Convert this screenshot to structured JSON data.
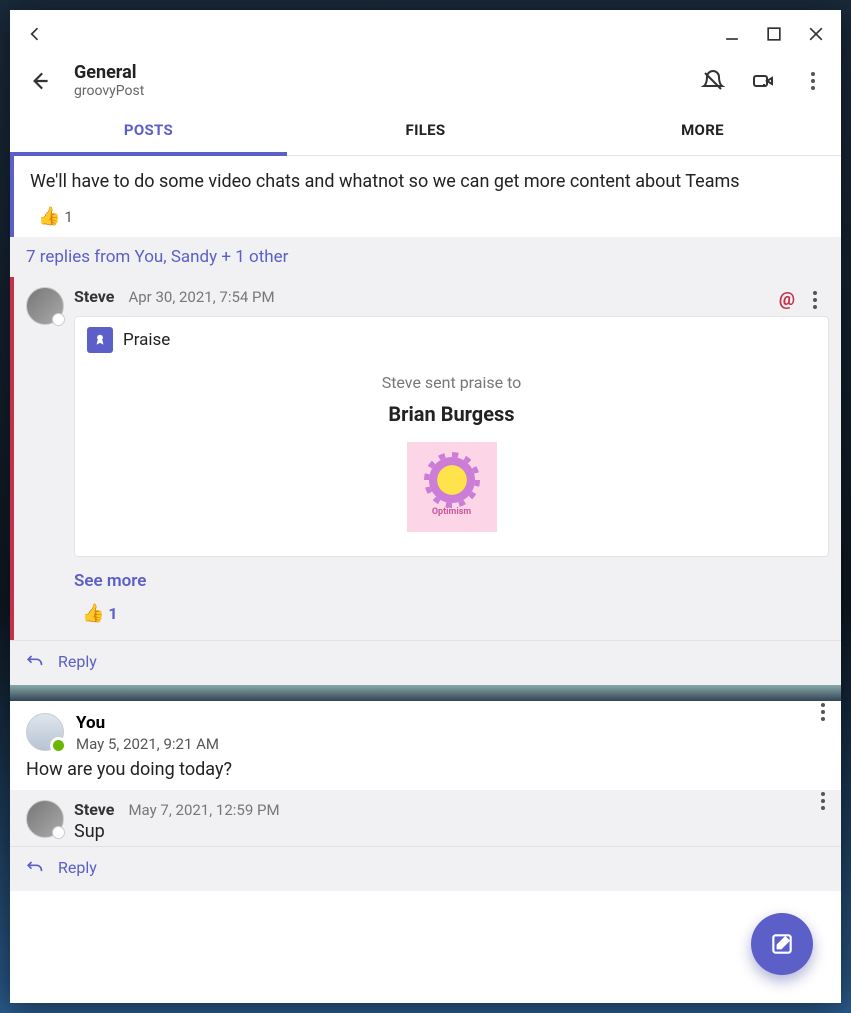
{
  "header": {
    "title": "General",
    "subtitle": "groovyPost"
  },
  "tabs": [
    {
      "label": "POSTS",
      "active": true
    },
    {
      "label": "FILES",
      "active": false
    },
    {
      "label": "MORE",
      "active": false
    }
  ],
  "root_post": {
    "text": "We'll have to do some video chats and whatnot so we can get more content about Teams",
    "reaction_count": "1",
    "replies_summary": "7 replies from You, Sandy + 1 other"
  },
  "praise_reply": {
    "author": "Steve",
    "timestamp": "Apr 30, 2021, 7:54 PM",
    "card_title": "Praise",
    "subtext": "Steve sent praise to",
    "target_name": "Brian Burgess",
    "stamp_label": "Optimism",
    "see_more": "See more",
    "reaction_count": "1"
  },
  "reply_label": "Reply",
  "you_post": {
    "author": "You",
    "timestamp": "May 5, 2021, 9:21 AM",
    "text": "How are you doing today?"
  },
  "steve_reply": {
    "author": "Steve",
    "timestamp": "May 7, 2021, 12:59 PM",
    "text": "Sup"
  }
}
